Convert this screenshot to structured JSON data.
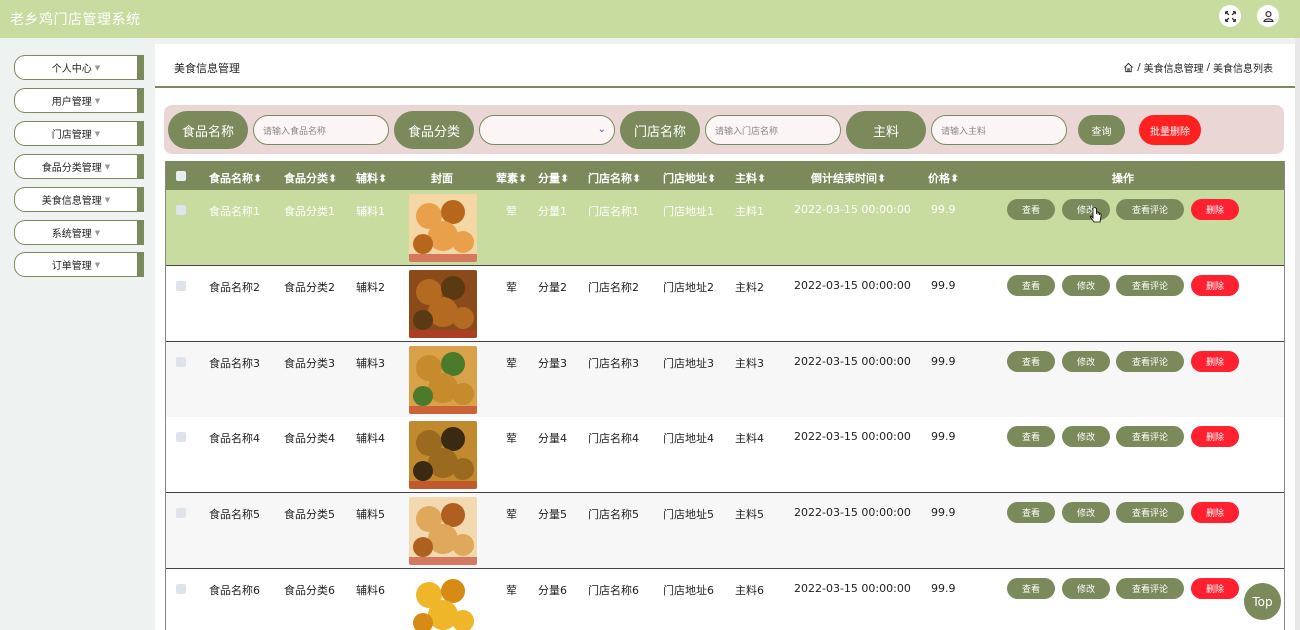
{
  "app": {
    "title": "老乡鸡门店管理系统"
  },
  "colors": {
    "header": "#c8dca0",
    "accent": "#7a8a5a",
    "danger": "#ff2030",
    "highlight_row": "#c8dca0",
    "search_panel": "#ead7d5"
  },
  "header": {
    "fullscreen_icon": "fullscreen-icon",
    "user_icon": "user-icon"
  },
  "sidebar": {
    "items": [
      {
        "label": "个人中心"
      },
      {
        "label": "用户管理"
      },
      {
        "label": "门店管理"
      },
      {
        "label": "食品分类管理"
      },
      {
        "label": "美食信息管理"
      },
      {
        "label": "系统管理"
      },
      {
        "label": "订单管理"
      }
    ]
  },
  "page": {
    "title": "美食信息管理",
    "breadcrumb": [
      "美食信息管理",
      "美食信息列表"
    ],
    "breadcrumb_sep": "/"
  },
  "search": {
    "food_name_label": "食品名称",
    "food_name_placeholder": "请输入食品名称",
    "category_label": "食品分类",
    "category_value": "",
    "store_name_label": "门店名称",
    "store_name_placeholder": "请输入门店名称",
    "main_ingredient_label": "主料",
    "main_ingredient_placeholder": "请输入主料",
    "query_button": "查询",
    "bulk_delete_button": "批量删除"
  },
  "table": {
    "columns": [
      "食品名称",
      "食品分类",
      "辅料",
      "封面",
      "荤素",
      "分量",
      "门店名称",
      "门店地址",
      "主料",
      "倒计结束时间",
      "价格",
      "操作"
    ],
    "sort_arrow": "⬍",
    "actions": {
      "view": "查看",
      "edit": "修改",
      "review": "查看评论",
      "delete": "删除"
    },
    "rows": [
      {
        "name": "食品名称1",
        "category": "食品分类1",
        "side": "辅料1",
        "meat": "荤",
        "portion": "分量1",
        "store": "门店名称1",
        "address": "门店地址1",
        "main": "主料1",
        "end_time": "2022-03-15 00:00:00",
        "price": "99.9"
      },
      {
        "name": "食品名称2",
        "category": "食品分类2",
        "side": "辅料2",
        "meat": "荤",
        "portion": "分量2",
        "store": "门店名称2",
        "address": "门店地址2",
        "main": "主料2",
        "end_time": "2022-03-15 00:00:00",
        "price": "99.9"
      },
      {
        "name": "食品名称3",
        "category": "食品分类3",
        "side": "辅料3",
        "meat": "荤",
        "portion": "分量3",
        "store": "门店名称3",
        "address": "门店地址3",
        "main": "主料3",
        "end_time": "2022-03-15 00:00:00",
        "price": "99.9"
      },
      {
        "name": "食品名称4",
        "category": "食品分类4",
        "side": "辅料4",
        "meat": "荤",
        "portion": "分量4",
        "store": "门店名称4",
        "address": "门店地址4",
        "main": "主料4",
        "end_time": "2022-03-15 00:00:00",
        "price": "99.9"
      },
      {
        "name": "食品名称5",
        "category": "食品分类5",
        "side": "辅料5",
        "meat": "荤",
        "portion": "分量5",
        "store": "门店名称5",
        "address": "门店地址5",
        "main": "主料5",
        "end_time": "2022-03-15 00:00:00",
        "price": "99.9"
      },
      {
        "name": "食品名称6",
        "category": "食品分类6",
        "side": "辅料6",
        "meat": "荤",
        "portion": "分量6",
        "store": "门店名称6",
        "address": "门店地址6",
        "main": "主料6",
        "end_time": "2022-03-15 00:00:00",
        "price": "99.9"
      }
    ]
  },
  "top_button": "Top"
}
